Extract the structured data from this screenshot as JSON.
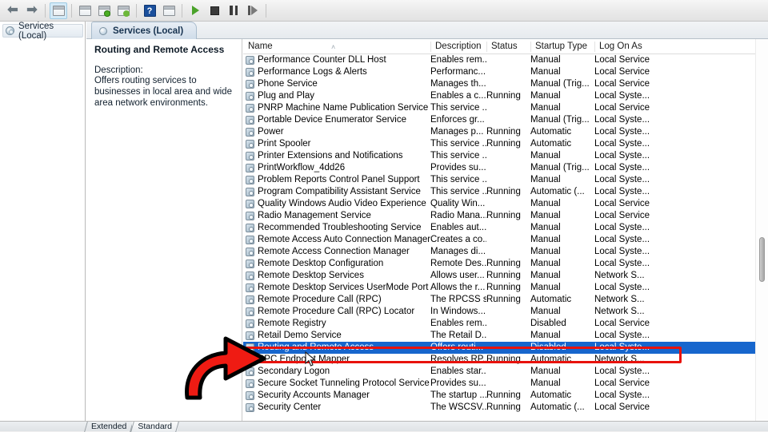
{
  "window": {
    "tree_root_label": "Services (Local)",
    "pane_tab_label": "Services (Local)"
  },
  "toolbar": {
    "buttons": [
      {
        "name": "back-button",
        "icon": "left-arrow-icon",
        "label": "Back"
      },
      {
        "name": "forward-button",
        "icon": "right-arrow-icon",
        "label": "Forward"
      },
      {
        "name": "show-hide-console-tree-button",
        "icon": "console-tree-icon",
        "label": "Show/Hide Console Tree"
      },
      {
        "name": "properties-button",
        "icon": "properties-window-icon",
        "label": "Properties"
      },
      {
        "name": "refresh-button",
        "icon": "refresh-icon",
        "label": "Refresh"
      },
      {
        "name": "export-list-button",
        "icon": "export-list-icon",
        "label": "Export List"
      },
      {
        "name": "help-button",
        "icon": "help-question-icon",
        "label": "Help"
      },
      {
        "name": "show-action-pane-button",
        "icon": "action-pane-icon",
        "label": "Show/Hide Action Pane"
      },
      {
        "name": "start-service-button",
        "icon": "play-icon",
        "label": "Start Service"
      },
      {
        "name": "stop-service-button",
        "icon": "stop-icon",
        "label": "Stop Service"
      },
      {
        "name": "pause-service-button",
        "icon": "pause-icon",
        "label": "Pause Service"
      },
      {
        "name": "restart-service-button",
        "icon": "restart-icon",
        "label": "Restart Service"
      }
    ]
  },
  "details": {
    "title": "Routing and Remote Access",
    "description_label": "Description:",
    "description_text": "Offers routing services to businesses in local area and wide area network environments."
  },
  "list": {
    "columns": [
      "Name",
      "Description",
      "Status",
      "Startup Type",
      "Log On As"
    ],
    "sort_indicator": "˄",
    "selected_index": 24,
    "rows": [
      {
        "name": "Performance Counter DLL Host",
        "description": "Enables rem...",
        "status": "",
        "startup": "Manual",
        "logon": "Local Service"
      },
      {
        "name": "Performance Logs & Alerts",
        "description": "Performanc...",
        "status": "",
        "startup": "Manual",
        "logon": "Local Service"
      },
      {
        "name": "Phone Service",
        "description": "Manages th...",
        "status": "",
        "startup": "Manual (Trig...",
        "logon": "Local Service"
      },
      {
        "name": "Plug and Play",
        "description": "Enables a c...",
        "status": "Running",
        "startup": "Manual",
        "logon": "Local Syste..."
      },
      {
        "name": "PNRP Machine Name Publication Service",
        "description": "This service ...",
        "status": "",
        "startup": "Manual",
        "logon": "Local Service"
      },
      {
        "name": "Portable Device Enumerator Service",
        "description": "Enforces gr...",
        "status": "",
        "startup": "Manual (Trig...",
        "logon": "Local Syste..."
      },
      {
        "name": "Power",
        "description": "Manages p...",
        "status": "Running",
        "startup": "Automatic",
        "logon": "Local Syste..."
      },
      {
        "name": "Print Spooler",
        "description": "This service ...",
        "status": "Running",
        "startup": "Automatic",
        "logon": "Local Syste..."
      },
      {
        "name": "Printer Extensions and Notifications",
        "description": "This service ...",
        "status": "",
        "startup": "Manual",
        "logon": "Local Syste..."
      },
      {
        "name": "PrintWorkflow_4dd26",
        "description": "Provides su...",
        "status": "",
        "startup": "Manual (Trig...",
        "logon": "Local Syste..."
      },
      {
        "name": "Problem Reports Control Panel Support",
        "description": "This service ...",
        "status": "",
        "startup": "Manual",
        "logon": "Local Syste..."
      },
      {
        "name": "Program Compatibility Assistant Service",
        "description": "This service ...",
        "status": "Running",
        "startup": "Automatic (...",
        "logon": "Local Syste..."
      },
      {
        "name": "Quality Windows Audio Video Experience",
        "description": "Quality Win...",
        "status": "",
        "startup": "Manual",
        "logon": "Local Service"
      },
      {
        "name": "Radio Management Service",
        "description": "Radio Mana...",
        "status": "Running",
        "startup": "Manual",
        "logon": "Local Service"
      },
      {
        "name": "Recommended Troubleshooting Service",
        "description": "Enables aut...",
        "status": "",
        "startup": "Manual",
        "logon": "Local Syste..."
      },
      {
        "name": "Remote Access Auto Connection Manager",
        "description": "Creates a co...",
        "status": "",
        "startup": "Manual",
        "logon": "Local Syste..."
      },
      {
        "name": "Remote Access Connection Manager",
        "description": "Manages di...",
        "status": "",
        "startup": "Manual",
        "logon": "Local Syste..."
      },
      {
        "name": "Remote Desktop Configuration",
        "description": "Remote Des...",
        "status": "Running",
        "startup": "Manual",
        "logon": "Local Syste..."
      },
      {
        "name": "Remote Desktop Services",
        "description": "Allows user...",
        "status": "Running",
        "startup": "Manual",
        "logon": "Network S..."
      },
      {
        "name": "Remote Desktop Services UserMode Port R...",
        "description": "Allows the r...",
        "status": "Running",
        "startup": "Manual",
        "logon": "Local Syste..."
      },
      {
        "name": "Remote Procedure Call (RPC)",
        "description": "The RPCSS s...",
        "status": "Running",
        "startup": "Automatic",
        "logon": "Network S..."
      },
      {
        "name": "Remote Procedure Call (RPC) Locator",
        "description": "In Windows...",
        "status": "",
        "startup": "Manual",
        "logon": "Network S..."
      },
      {
        "name": "Remote Registry",
        "description": "Enables rem...",
        "status": "",
        "startup": "Disabled",
        "logon": "Local Service"
      },
      {
        "name": "Retail Demo Service",
        "description": "The Retail D...",
        "status": "",
        "startup": "Manual",
        "logon": "Local Syste..."
      },
      {
        "name": "Routing and Remote Access",
        "description": "Offers routi...",
        "status": "",
        "startup": "Disabled",
        "logon": "Local Syste..."
      },
      {
        "name": "RPC Endpoint Mapper",
        "description": "Resolves RP...",
        "status": "Running",
        "startup": "Automatic",
        "logon": "Network S..."
      },
      {
        "name": "Secondary Logon",
        "description": "Enables star...",
        "status": "",
        "startup": "Manual",
        "logon": "Local Syste..."
      },
      {
        "name": "Secure Socket Tunneling Protocol Service",
        "description": "Provides su...",
        "status": "",
        "startup": "Manual",
        "logon": "Local Service"
      },
      {
        "name": "Security Accounts Manager",
        "description": "The startup ...",
        "status": "Running",
        "startup": "Automatic",
        "logon": "Local Syste..."
      },
      {
        "name": "Security Center",
        "description": "The WSCSV...",
        "status": "Running",
        "startup": "Automatic (...",
        "logon": "Local Service"
      }
    ]
  },
  "bottom_tabs": [
    {
      "label": "Extended",
      "active": false
    },
    {
      "label": "Standard",
      "active": true
    }
  ],
  "annotation": {
    "highlight_color": "#e8120c",
    "arrow_fill": "#ef1b13",
    "arrow_stroke": "#000000",
    "target_row": "Routing and Remote Access"
  },
  "colors": {
    "selection_blue": "#1766cd",
    "selection_text": "#ffffff"
  }
}
